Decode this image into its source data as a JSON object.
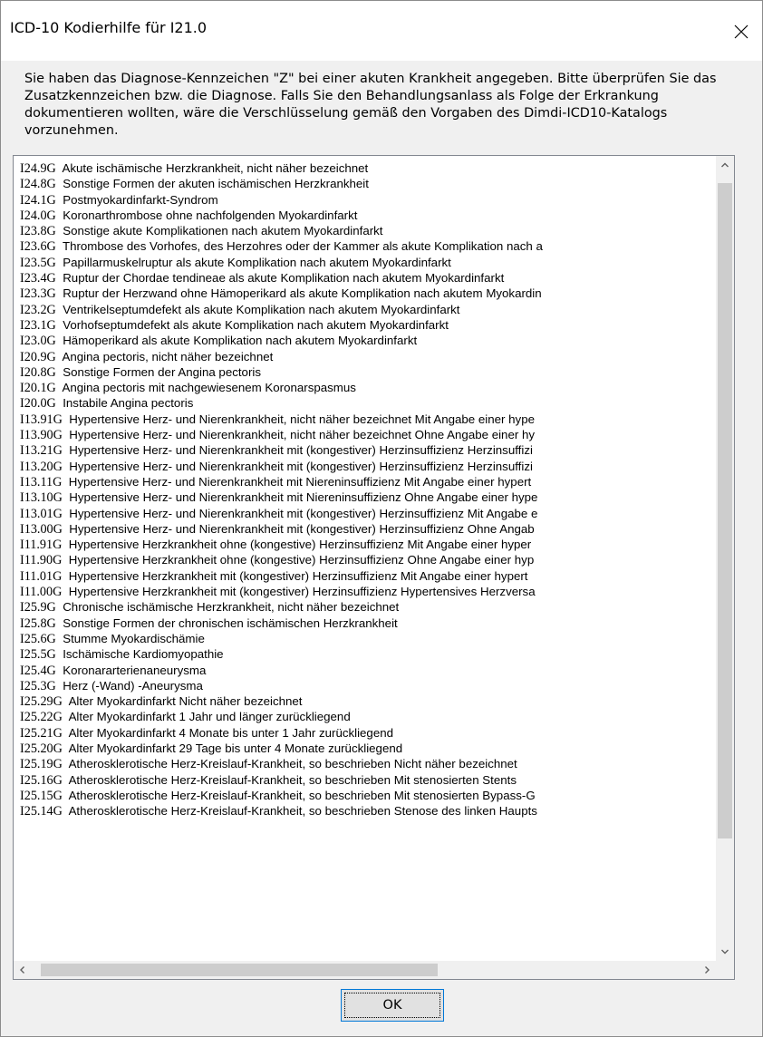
{
  "window": {
    "title": "ICD-10 Kodierhilfe für I21.0",
    "message": "Sie haben das Diagnose-Kennzeichen \"Z\" bei einer akuten Krankheit angegeben. Bitte überprüfen Sie das Zusatzkennzeichen bzw. die Diagnose. Falls Sie den Behandlungsanlass als Folge der Erkrankung dokumentieren wollten, wäre die Verschlüsselung gemäß den Vorgaben des Dimdi-ICD10-Katalogs vorzunehmen."
  },
  "icons": {
    "close": "close-icon",
    "scroll_up": "chevron-up-icon",
    "scroll_down": "chevron-down-icon",
    "scroll_left": "chevron-left-icon",
    "scroll_right": "chevron-right-icon"
  },
  "diagnoses": [
    {
      "code": "I24.9G",
      "text": "Akute ischämische Herzkrankheit, nicht näher bezeichnet"
    },
    {
      "code": "I24.8G",
      "text": "Sonstige Formen der akuten ischämischen Herzkrankheit"
    },
    {
      "code": "I24.1G",
      "text": "Postmyokardinfarkt-Syndrom"
    },
    {
      "code": "I24.0G",
      "text": "Koronarthrombose ohne nachfolgenden Myokardinfarkt"
    },
    {
      "code": "I23.8G",
      "text": "Sonstige akute Komplikationen nach akutem Myokardinfarkt"
    },
    {
      "code": "I23.6G",
      "text": "Thrombose des Vorhofes, des Herzohres oder der Kammer als akute Komplikation nach a"
    },
    {
      "code": "I23.5G",
      "text": "Papillarmuskelruptur als akute Komplikation nach akutem Myokardinfarkt"
    },
    {
      "code": "I23.4G",
      "text": "Ruptur der Chordae tendineae als akute Komplikation nach akutem Myokardinfarkt"
    },
    {
      "code": "I23.3G",
      "text": "Ruptur der Herzwand ohne Hämoperikard als akute Komplikation nach akutem Myokardin"
    },
    {
      "code": "I23.2G",
      "text": "Ventrikelseptumdefekt als akute Komplikation nach akutem Myokardinfarkt"
    },
    {
      "code": "I23.1G",
      "text": "Vorhofseptumdefekt als akute Komplikation nach akutem Myokardinfarkt"
    },
    {
      "code": "I23.0G",
      "text": "Hämoperikard als akute Komplikation nach akutem Myokardinfarkt"
    },
    {
      "code": "I20.9G",
      "text": "Angina pectoris, nicht näher bezeichnet"
    },
    {
      "code": "I20.8G",
      "text": "Sonstige Formen der Angina pectoris"
    },
    {
      "code": "I20.1G",
      "text": "Angina pectoris mit nachgewiesenem Koronarspasmus"
    },
    {
      "code": "I20.0G",
      "text": "Instabile Angina pectoris"
    },
    {
      "code": "I13.91G",
      "text": "Hypertensive Herz- und Nierenkrankheit, nicht näher bezeichnet Mit Angabe einer hype"
    },
    {
      "code": "I13.90G",
      "text": "Hypertensive Herz- und Nierenkrankheit, nicht näher bezeichnet Ohne Angabe einer hy"
    },
    {
      "code": "I13.21G",
      "text": "Hypertensive Herz- und Nierenkrankheit mit (kongestiver) Herzinsuffizienz Herzinsuffizi"
    },
    {
      "code": "I13.20G",
      "text": "Hypertensive Herz- und Nierenkrankheit mit (kongestiver) Herzinsuffizienz Herzinsuffizi"
    },
    {
      "code": "I13.11G",
      "text": "Hypertensive Herz- und Nierenkrankheit mit Niereninsuffizienz Mit Angabe einer hypert"
    },
    {
      "code": "I13.10G",
      "text": "Hypertensive Herz- und Nierenkrankheit mit Niereninsuffizienz Ohne Angabe einer hype"
    },
    {
      "code": "I13.01G",
      "text": "Hypertensive Herz- und Nierenkrankheit mit (kongestiver) Herzinsuffizienz Mit Angabe e"
    },
    {
      "code": "I13.00G",
      "text": "Hypertensive Herz- und Nierenkrankheit mit (kongestiver) Herzinsuffizienz Ohne Angab"
    },
    {
      "code": "I11.91G",
      "text": "Hypertensive Herzkrankheit ohne (kongestive) Herzinsuffizienz Mit Angabe einer hyper"
    },
    {
      "code": "I11.90G",
      "text": "Hypertensive Herzkrankheit ohne (kongestive) Herzinsuffizienz Ohne Angabe einer hyp"
    },
    {
      "code": "I11.01G",
      "text": "Hypertensive Herzkrankheit mit (kongestiver) Herzinsuffizienz Mit Angabe einer hypert"
    },
    {
      "code": "I11.00G",
      "text": "Hypertensive Herzkrankheit mit (kongestiver) Herzinsuffizienz Hypertensives Herzversa"
    },
    {
      "code": "I25.9G",
      "text": "Chronische ischämische Herzkrankheit, nicht näher bezeichnet"
    },
    {
      "code": "I25.8G",
      "text": "Sonstige Formen der chronischen ischämischen Herzkrankheit"
    },
    {
      "code": "I25.6G",
      "text": "Stumme Myokardischämie"
    },
    {
      "code": "I25.5G",
      "text": "Ischämische Kardiomyopathie"
    },
    {
      "code": "I25.4G",
      "text": "Koronararterienaneurysma"
    },
    {
      "code": "I25.3G",
      "text": "Herz (-Wand) -Aneurysma"
    },
    {
      "code": "I25.29G",
      "text": "Alter Myokardinfarkt Nicht näher bezeichnet"
    },
    {
      "code": "I25.22G",
      "text": "Alter Myokardinfarkt 1 Jahr und länger zurückliegend"
    },
    {
      "code": "I25.21G",
      "text": "Alter Myokardinfarkt 4 Monate bis unter 1 Jahr zurückliegend"
    },
    {
      "code": "I25.20G",
      "text": "Alter Myokardinfarkt 29 Tage bis unter 4 Monate zurückliegend"
    },
    {
      "code": "I25.19G",
      "text": "Atherosklerotische Herz-Kreislauf-Krankheit, so beschrieben Nicht näher bezeichnet"
    },
    {
      "code": "I25.16G",
      "text": "Atherosklerotische Herz-Kreislauf-Krankheit, so beschrieben Mit stenosierten Stents"
    },
    {
      "code": "I25.15G",
      "text": "Atherosklerotische Herz-Kreislauf-Krankheit, so beschrieben Mit stenosierten Bypass-G"
    },
    {
      "code": "I25.14G",
      "text": "Atherosklerotische Herz-Kreislauf-Krankheit, so beschrieben Stenose des linken Haupts"
    }
  ],
  "buttons": {
    "ok": "OK"
  },
  "colors": {
    "focus_border": "#0078d7",
    "button_face": "#e1e1e1",
    "window_bg": "#f0f0f0"
  }
}
